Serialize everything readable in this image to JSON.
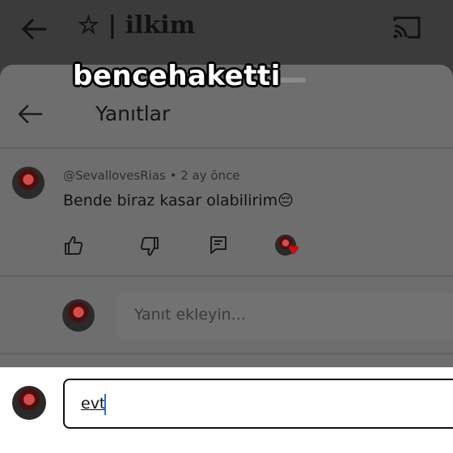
{
  "header": {
    "title": "☆ | ilkim",
    "back_icon": "arrow-left-icon",
    "cast_icon": "cast-icon"
  },
  "overlay": {
    "text": "bencehaketti"
  },
  "sheet": {
    "title": "Yanıtlar",
    "back_icon": "arrow-left-icon"
  },
  "comment": {
    "author": "@SevallovesRias • 2 ay önce",
    "text": "Bende biraz kasar olabilirim😔",
    "actions": [
      "like-icon",
      "dislike-icon",
      "reply-icon",
      "creator-heart-icon"
    ]
  },
  "reply": {
    "placeholder": "Yanıt ekleyin..."
  },
  "compose": {
    "value": "evt"
  },
  "colors": {
    "accent_caret": "#1a73e8",
    "heart": "#c81010"
  }
}
